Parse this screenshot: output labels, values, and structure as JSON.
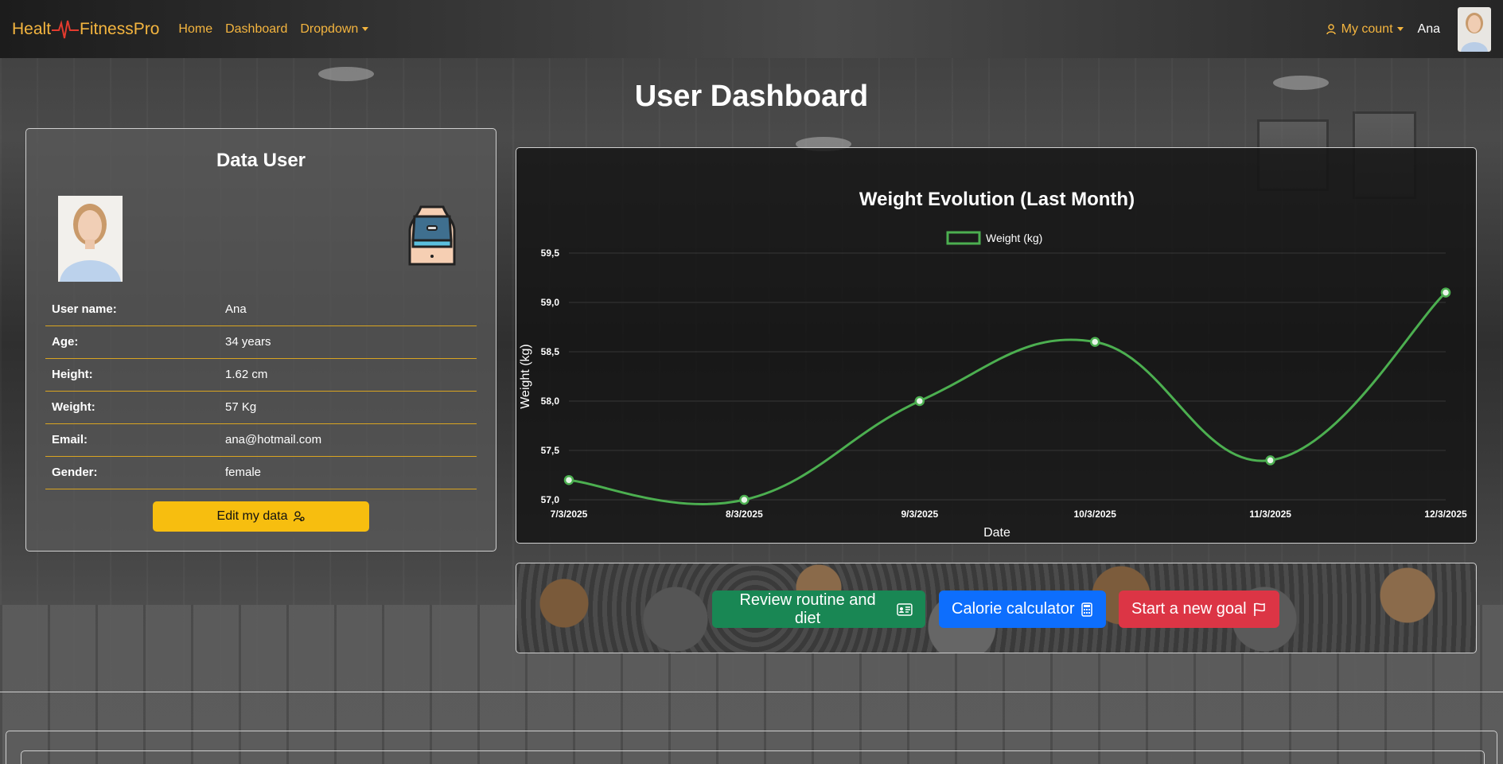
{
  "navbar": {
    "brand_left": "Healt",
    "brand_right": "FitnessPro",
    "links": [
      "Home",
      "Dashboard",
      "Dropdown"
    ],
    "account_label": "My count",
    "username": "Ana"
  },
  "page": {
    "title": "User Dashboard"
  },
  "user_card": {
    "title": "Data User",
    "rows": [
      {
        "label": "User name:",
        "value": "Ana"
      },
      {
        "label": "Age:",
        "value": "34 years"
      },
      {
        "label": "Height:",
        "value": "1.62 cm"
      },
      {
        "label": "Weight:",
        "value": "57 Kg"
      },
      {
        "label": "Email:",
        "value": "ana@hotmail.com"
      },
      {
        "label": "Gender:",
        "value": "female"
      }
    ],
    "edit_button": "Edit my data"
  },
  "chart_data": {
    "type": "line",
    "title": "Weight Evolution (Last Month)",
    "xlabel": "Date",
    "ylabel": "Weight (kg)",
    "categories": [
      "7/3/2025",
      "8/3/2025",
      "9/3/2025",
      "10/3/2025",
      "11/3/2025",
      "12/3/2025"
    ],
    "series": [
      {
        "name": "Weight (kg)",
        "values": [
          57.2,
          57.0,
          58.0,
          58.6,
          57.4,
          59.1
        ]
      }
    ],
    "ylim": [
      57.0,
      59.5
    ],
    "yticks": [
      "57,0",
      "57,5",
      "58,0",
      "58,5",
      "59,0",
      "59,5"
    ],
    "legend": "top",
    "grid": true,
    "color": "#4caf50"
  },
  "actions": {
    "review": "Review routine and diet",
    "calorie": "Calorie calculator",
    "goal": "Start a new goal"
  },
  "colors": {
    "accent": "#f4b53f",
    "green": "#198754",
    "blue": "#0d6efd",
    "red": "#dc3545",
    "yellow": "#f7be0f"
  }
}
